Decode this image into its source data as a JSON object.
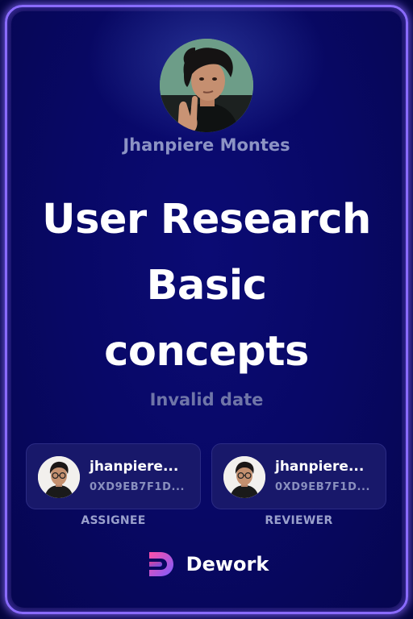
{
  "task": {
    "owner_name": "Jhanpiere Montes",
    "title_lines": [
      "User Research",
      "Basic",
      "concepts"
    ],
    "date": "Invalid date"
  },
  "assignee": {
    "name": "jhanpiere...",
    "address": "0XD9EB7F1D...",
    "role": "ASSIGNEE"
  },
  "reviewer": {
    "name": "jhanpiere...",
    "address": "0XD9EB7F1D...",
    "role": "REVIEWER"
  },
  "brand": {
    "name": "Dework"
  },
  "colors": {
    "background": "#070757",
    "frame_glow": "#8a6bff",
    "muted_text": "#8c93c4",
    "brand_gradient_start": "#ff4fa8",
    "brand_gradient_end": "#7a5cff"
  },
  "icons": {
    "owner_avatar": "avatar-photo",
    "person_avatar": "avatar-photo",
    "brand_logo": "dework-logo"
  }
}
